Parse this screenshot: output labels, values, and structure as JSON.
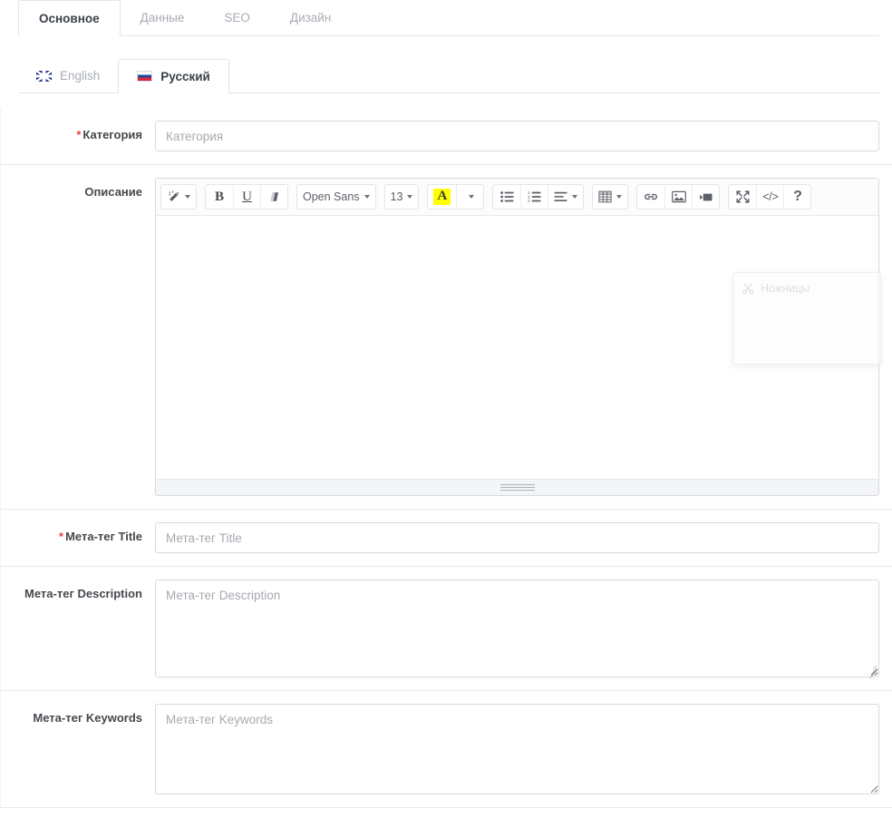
{
  "main_tabs": [
    {
      "label": "Основное",
      "active": true
    },
    {
      "label": "Данные",
      "active": false
    },
    {
      "label": "SEO",
      "active": false
    },
    {
      "label": "Дизайн",
      "active": false
    }
  ],
  "language_tabs": [
    {
      "label": "English",
      "flag": "flag-uk-icon",
      "active": false
    },
    {
      "label": "Русский",
      "flag": "flag-ru-icon",
      "active": true
    }
  ],
  "form": {
    "category": {
      "label": "Категория",
      "required_marker": "*",
      "placeholder": "Категория",
      "value": ""
    },
    "description": {
      "label": "Описание",
      "value": ""
    },
    "meta_title": {
      "label": "Мета-тег Title",
      "required_marker": "*",
      "placeholder": "Мета-тег Title",
      "value": ""
    },
    "meta_description": {
      "label": "Мета-тег Description",
      "placeholder": "Мета-тег Description",
      "value": ""
    },
    "meta_keywords": {
      "label": "Мета-тег Keywords",
      "placeholder": "Мета-тег Keywords",
      "value": ""
    }
  },
  "editor_toolbar": {
    "magic_wand": "magic-wand-icon",
    "bold": "B",
    "underline": "U",
    "clear_format": "eraser-icon",
    "font_name": "Open Sans",
    "font_size": "13",
    "highlight_letter": "A",
    "highlight_color": "#ffff00",
    "unordered_list": "bullet-list-icon",
    "ordered_list": "numbered-list-icon",
    "align": "align-icon",
    "table": "table-icon",
    "link": "link-icon",
    "image": "image-icon",
    "video": "video-icon",
    "fullscreen": "fullscreen-icon",
    "code_view": "</>",
    "help": "?"
  },
  "ghost_window": {
    "title": "Ножницы",
    "icon": "scissors-icon"
  },
  "colors": {
    "required": "#e8463f",
    "highlight": "#ffff00",
    "border": "#d6d9dd",
    "text": "#45484d",
    "muted": "#a8acb3"
  }
}
